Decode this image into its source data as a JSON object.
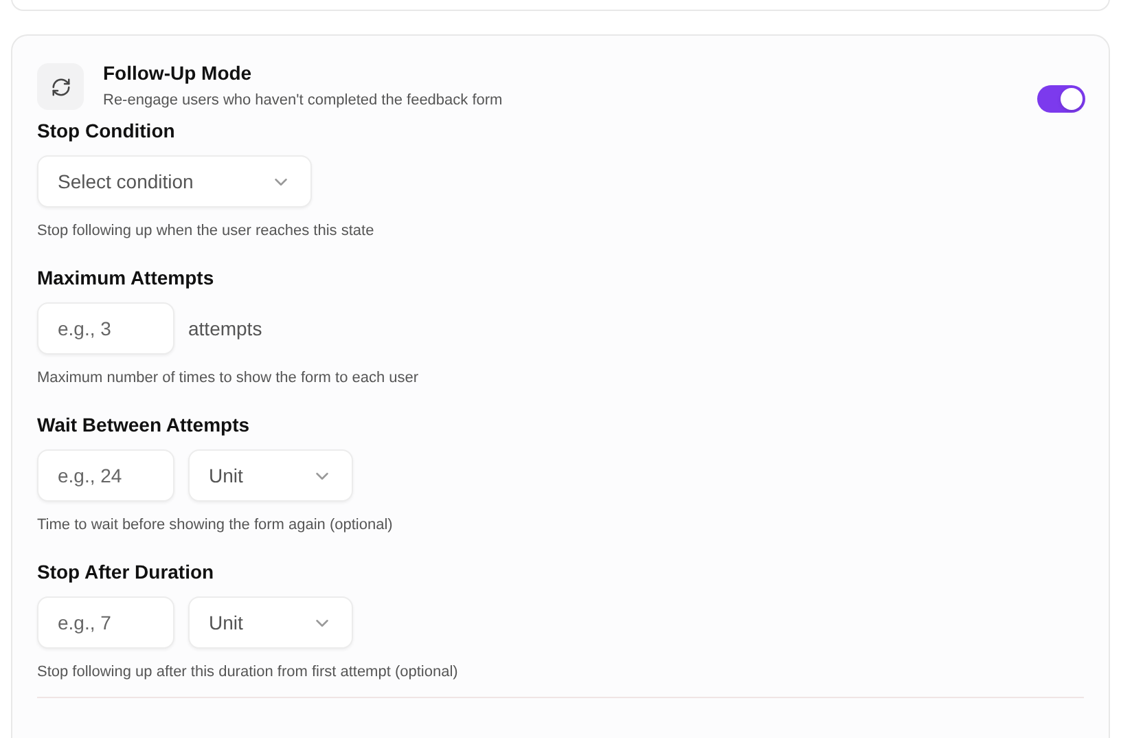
{
  "section": {
    "title": "Follow-Up Mode",
    "description": "Re-engage users who haven't completed the feedback form",
    "enabled": true
  },
  "fields": [
    {
      "label": "Stop Condition",
      "help": "Stop following up when the user reaches this state",
      "controls": [
        {
          "kind": "select",
          "placeholder": "Select condition"
        }
      ]
    },
    {
      "label": "Maximum Attempts",
      "help": "Maximum number of times to show the form to each user",
      "controls": [
        {
          "kind": "input",
          "placeholder": "e.g., 3"
        },
        {
          "kind": "suffix",
          "text": "attempts"
        }
      ]
    },
    {
      "label": "Wait Between Attempts",
      "help": "Time to wait before showing the form again (optional)",
      "controls": [
        {
          "kind": "input",
          "placeholder": "e.g., 24"
        },
        {
          "kind": "select",
          "placeholder": "Unit"
        }
      ]
    },
    {
      "label": "Stop After Duration",
      "help": "Stop following up after this duration from first attempt (optional)",
      "controls": [
        {
          "kind": "input",
          "placeholder": "e.g., 7"
        },
        {
          "kind": "select",
          "placeholder": "Unit"
        }
      ]
    }
  ]
}
